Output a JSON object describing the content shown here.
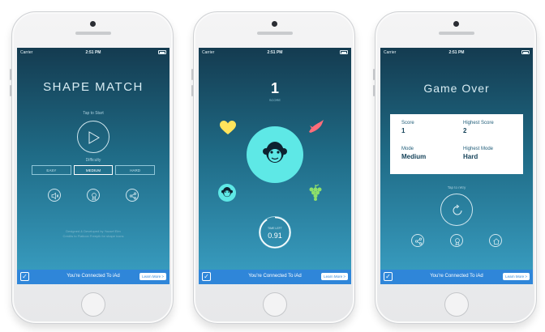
{
  "status": {
    "carrier": "Carrier",
    "time": "2:51 PM"
  },
  "ad": {
    "text": "You're Connected To iAd",
    "learn_more": "Learn More >"
  },
  "screen1": {
    "title": "SHAPE MATCH",
    "tap_to_start": "Tap to Start",
    "difficulty_label": "Difficulty",
    "difficulties": [
      "EASY",
      "MEDIUM",
      "HARD"
    ],
    "selected_difficulty": "MEDIUM",
    "credits_line1": "Designed & Developed by Yousef Elm",
    "credits_line2": "Credits to Flaticon Freepik for shape icons"
  },
  "screen2": {
    "score": "1",
    "score_label": "SCORE",
    "timer_label": "TIME LEFT",
    "timer_value": "0.91",
    "timer_fraction": 0.91,
    "colors": {
      "accent": "#5ee8e6",
      "heart": "#ffe45c",
      "bird": "#ff6d7a",
      "grapes": "#8ee06a"
    }
  },
  "screen3": {
    "title": "Game Over",
    "score_label": "Score",
    "score_value": "1",
    "highest_score_label": "Highest Score",
    "highest_score_value": "2",
    "mode_label": "Mode",
    "mode_value": "Medium",
    "highest_mode_label": "Highest Mode",
    "highest_mode_value": "Hard",
    "tap_to_retry": "Tap to retry"
  }
}
